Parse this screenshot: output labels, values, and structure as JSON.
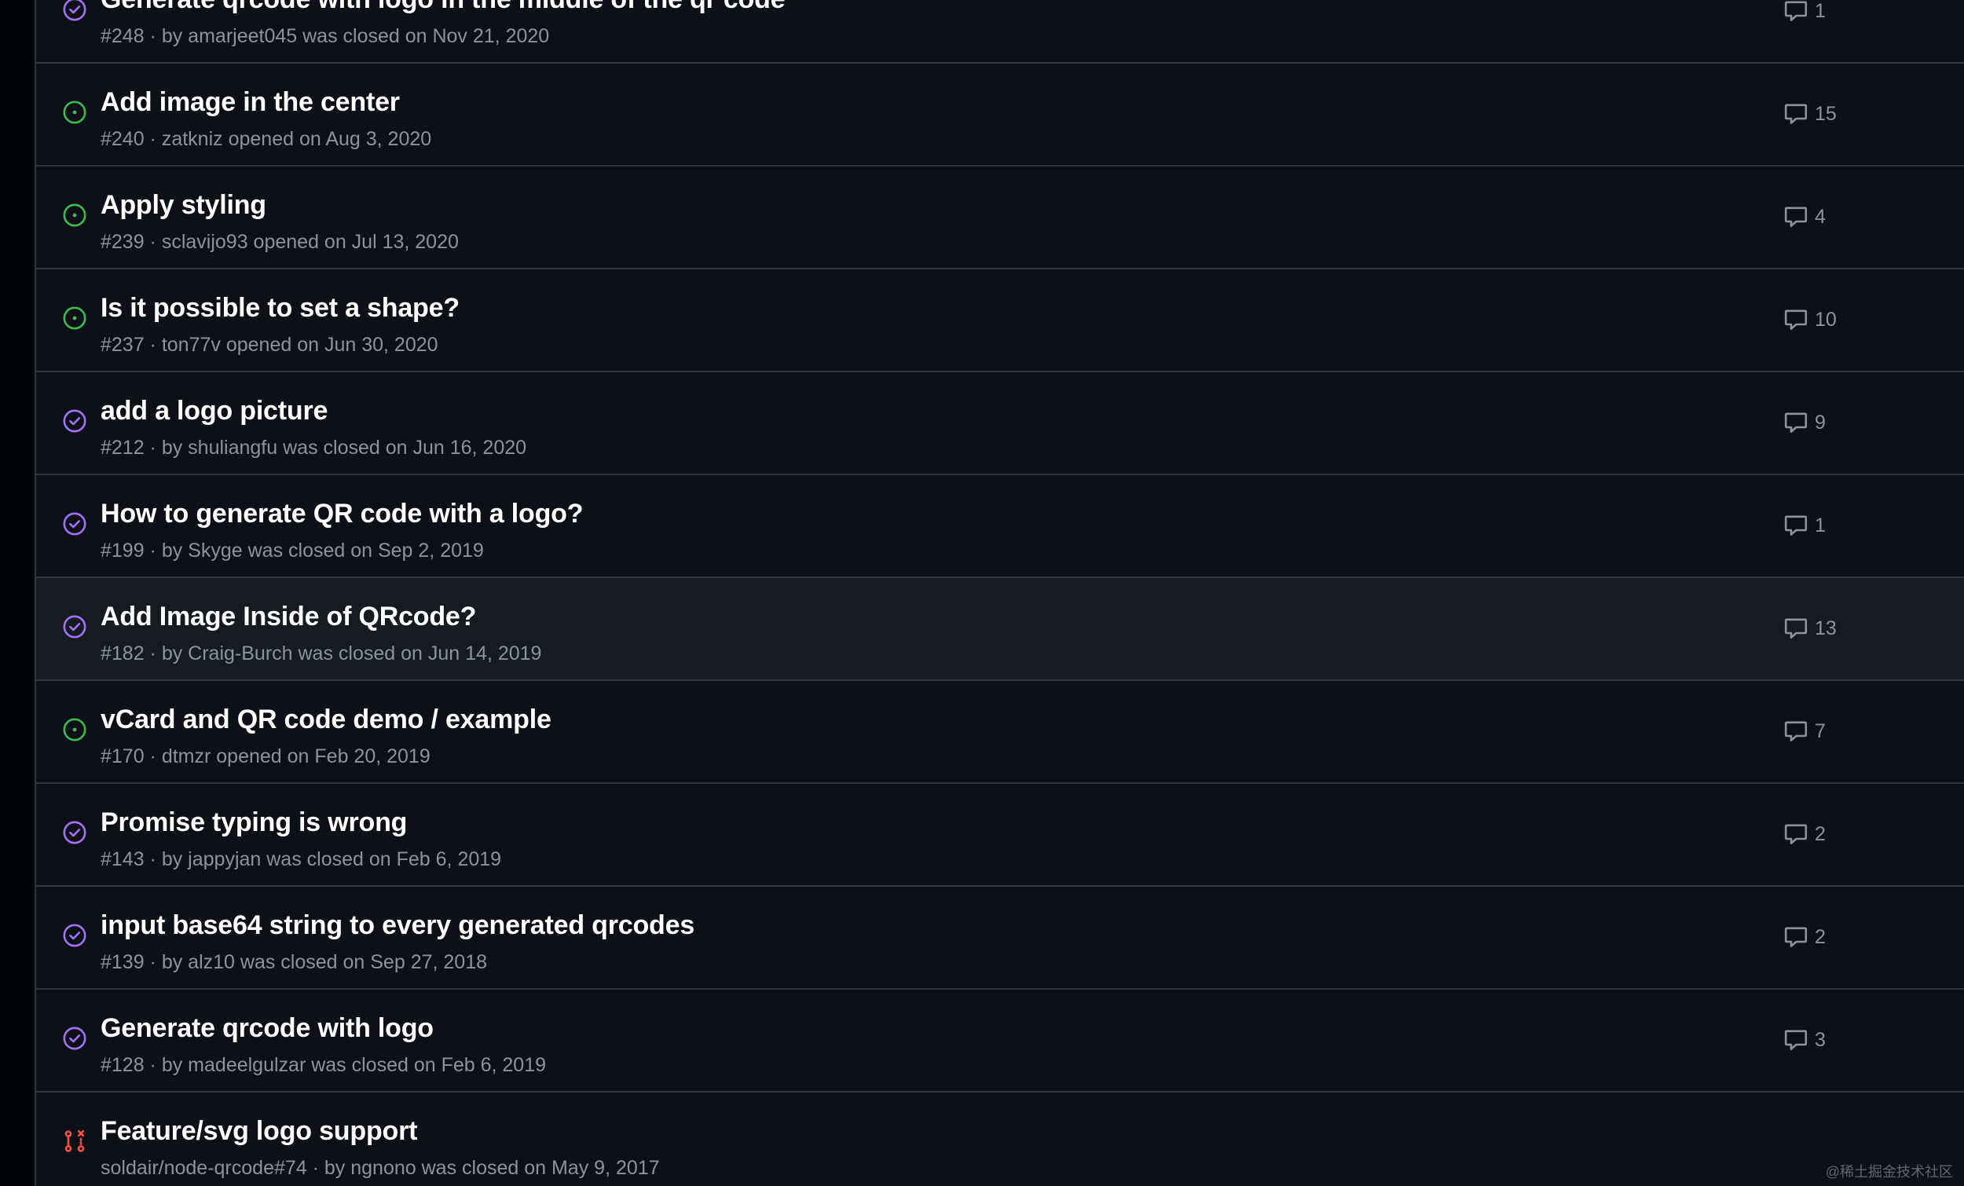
{
  "issues": [
    {
      "title": "Generate qrcode with logo in the middle of the qr code",
      "meta": "#248 · by amarjeet045 was closed on Nov 21, 2020",
      "comments": "1",
      "state": "closed"
    },
    {
      "title": "Add image in the center",
      "meta": "#240 · zatkniz opened on Aug 3, 2020",
      "comments": "15",
      "state": "open"
    },
    {
      "title": "Apply styling",
      "meta": "#239 · sclavijo93 opened on Jul 13, 2020",
      "comments": "4",
      "state": "open"
    },
    {
      "title": "Is it possible to set a shape?",
      "meta": "#237 · ton77v opened on Jun 30, 2020",
      "comments": "10",
      "state": "open"
    },
    {
      "title": "add a logo picture",
      "meta": "#212 · by shuliangfu was closed on Jun 16, 2020",
      "comments": "9",
      "state": "closed"
    },
    {
      "title": "How to generate QR code with a logo?",
      "meta": "#199 · by Skyge was closed on Sep 2, 2019",
      "comments": "1",
      "state": "closed"
    },
    {
      "title": "Add Image Inside of QRcode?",
      "meta": "#182 · by Craig-Burch was closed on Jun 14, 2019",
      "comments": "13",
      "state": "closed"
    },
    {
      "title": "vCard and QR code demo / example",
      "meta": "#170 · dtmzr opened on Feb 20, 2019",
      "comments": "7",
      "state": "open"
    },
    {
      "title": "Promise typing is wrong",
      "meta": "#143 · by jappyjan was closed on Feb 6, 2019",
      "comments": "2",
      "state": "closed"
    },
    {
      "title": "input base64 string to every generated qrcodes",
      "meta": "#139 · by alz10 was closed on Sep 27, 2018",
      "comments": "2",
      "state": "closed"
    },
    {
      "title": "Generate qrcode with logo",
      "meta": "#128 · by madeelgulzar was closed on Feb 6, 2019",
      "comments": "3",
      "state": "closed"
    },
    {
      "title": "Feature/svg logo support",
      "meta": "soldair/node-qrcode#74 · by ngnono was closed on May 9, 2017",
      "comments": "",
      "state": "pr-closed"
    }
  ],
  "hovered_index": 6,
  "watermark": "@稀土掘金技术社区",
  "colors": {
    "background": "#0d1117",
    "border": "#30363d",
    "title": "#ffffff",
    "muted": "#8b949e",
    "open": "#3fb950",
    "closed": "#a371f7",
    "pr_closed": "#f85149",
    "hover_row": "#161b22"
  },
  "icons": {
    "open": "issue-opened-icon",
    "closed": "issue-closed-icon",
    "pr-closed": "pull-request-closed-icon",
    "comments": "comment-icon"
  }
}
